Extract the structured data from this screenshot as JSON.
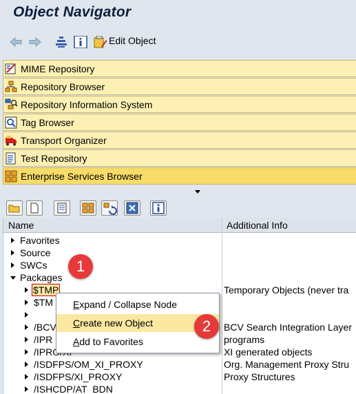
{
  "window": {
    "title": "Object Navigator"
  },
  "toolbar": {
    "edit_object_label": "Edit Object"
  },
  "nav_bars": [
    {
      "label": "MIME Repository",
      "icon": "mime-repository-icon"
    },
    {
      "label": "Repository Browser",
      "icon": "repository-browser-icon"
    },
    {
      "label": "Repository Information System",
      "icon": "repository-info-system-icon"
    },
    {
      "label": "Tag Browser",
      "icon": "tag-browser-icon"
    },
    {
      "label": "Transport Organizer",
      "icon": "transport-organizer-icon"
    },
    {
      "label": "Test Repository",
      "icon": "test-repository-icon"
    },
    {
      "label": "Enterprise Services Browser",
      "icon": "enterprise-services-icon"
    }
  ],
  "tree": {
    "columns": [
      "Name",
      "Additional Info"
    ],
    "rows": [
      {
        "name": "Favorites",
        "info": ""
      },
      {
        "name": "Source",
        "info": ""
      },
      {
        "name": "SWCs",
        "info": ""
      },
      {
        "name": "Packages",
        "info": ""
      },
      {
        "name": "$TMP",
        "info": "Temporary Objects (never tra"
      },
      {
        "name": "$TM",
        "info": ""
      },
      {
        "name": "",
        "info": ""
      },
      {
        "name": "/BCV",
        "info": "BCV Search Integration Layer"
      },
      {
        "name": "/IPR",
        "info": "programs"
      },
      {
        "name": "/IPRO/XI",
        "info": "XI generated objects"
      },
      {
        "name": "/ISDFPS/OM_XI_PROXY",
        "info": "Org. Management Proxy Stru"
      },
      {
        "name": "/ISDFPS/XI_PROXY",
        "info": "Proxy Structures"
      },
      {
        "name": "/ISHCDP/AT_BDN",
        "info": ""
      }
    ]
  },
  "context_menu": {
    "items": [
      "Expand / Collapse Node",
      "Create new Object",
      "Add to Favorites"
    ],
    "highlighted_index": 1
  },
  "callouts": [
    "1",
    "2"
  ]
}
